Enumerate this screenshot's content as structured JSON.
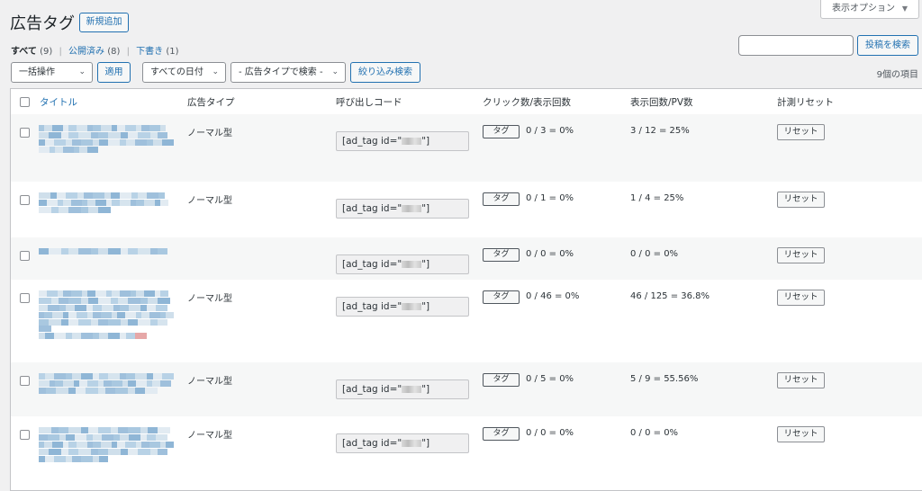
{
  "page": {
    "title": "広告タグ",
    "add_new_label": "新規追加",
    "screen_options_label": "表示オプション"
  },
  "views": {
    "all_label": "すべて",
    "all_count": "(9)",
    "published_label": "公開済み",
    "published_count": "(8)",
    "draft_label": "下書き",
    "draft_count": "(1)"
  },
  "search": {
    "value": "",
    "button_label": "投稿を検索"
  },
  "filters": {
    "bulk_action": "一括操作",
    "apply_label": "適用",
    "date": "すべての日付",
    "ad_type": "- 広告タイプで検索 -",
    "filter_label": "絞り込み検索"
  },
  "items_count": "9個の項目",
  "table": {
    "columns": [
      "タイトル",
      "広告タイプ",
      "呼び出しコード",
      "クリック数/表示回数",
      "表示回数/PV数",
      "計測リセット"
    ],
    "tag_button_label": "タグ",
    "reset_button_label": "リセット",
    "code_prefix": "[ad_tag id=\"",
    "code_suffix": "\"]",
    "rows": [
      {
        "type": "ノーマル型",
        "clicks": "0 / 3 = 0%",
        "views": "3 / 12 = 25%"
      },
      {
        "type": "ノーマル型",
        "clicks": "0 / 1 = 0%",
        "views": "1 / 4 = 25%"
      },
      {
        "type": "",
        "clicks": "0 / 0 = 0%",
        "views": "0 / 0 = 0%"
      },
      {
        "type": "ノーマル型",
        "clicks": "0 / 46 = 0%",
        "views": "46 / 125 = 36.8%"
      },
      {
        "type": "ノーマル型",
        "clicks": "0 / 5 = 0%",
        "views": "5 / 9 = 55.56%"
      },
      {
        "type": "ノーマル型",
        "clicks": "0 / 0 = 0%",
        "views": "0 / 0 = 0%"
      }
    ]
  },
  "colors": {
    "accent": "#2271b1",
    "background": "#f0f0f1"
  },
  "icons": {
    "dropdown": "chevron-down-icon",
    "screen_options_caret": "triangle-down-icon"
  }
}
